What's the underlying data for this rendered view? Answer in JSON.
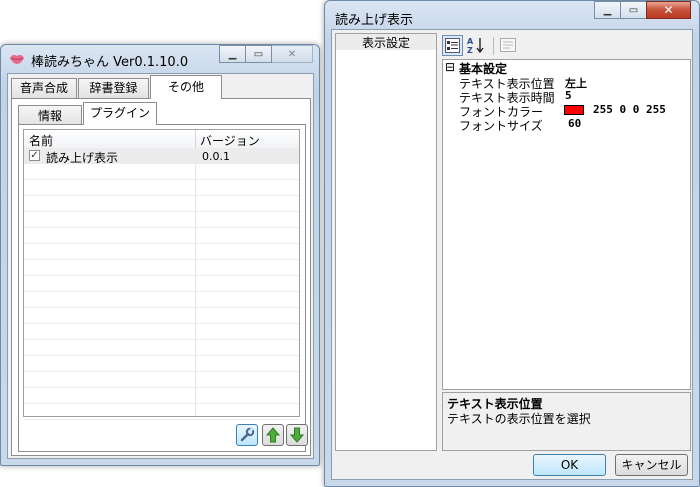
{
  "win1": {
    "title": "棒読みちゃん Ver0.1.10.0",
    "tabs": [
      {
        "label": "音声合成"
      },
      {
        "label": "辞書登録"
      },
      {
        "label": "その他"
      }
    ],
    "subtabs": [
      {
        "label": "情報"
      },
      {
        "label": "プラグイン"
      }
    ],
    "columns": {
      "name": "名前",
      "version": "バージョン"
    },
    "rows": [
      {
        "name": "読み上げ表示",
        "version": "0.0.1",
        "checked": true
      }
    ]
  },
  "win2": {
    "title": "読み上げ表示",
    "left_item": "表示設定",
    "category": "基本設定",
    "category_toggle": "⊟",
    "props": [
      {
        "label": "テキスト表示位置",
        "value": "左上"
      },
      {
        "label": "テキスト表示時間",
        "value": "5"
      },
      {
        "label": "フォントカラー",
        "value": "255 0 0 255",
        "swatch": "#ff0000"
      },
      {
        "label": "フォントサイズ",
        "value": "60"
      }
    ],
    "desc_title": "テキスト表示位置",
    "desc_text": "テキストの表示位置を選択",
    "ok": "OK",
    "cancel": "キャンセル"
  },
  "icons": {
    "app_icon": "lips-icon",
    "settings": "wrench-icon",
    "up": "arrow-up-icon",
    "down": "arrow-down-icon"
  }
}
